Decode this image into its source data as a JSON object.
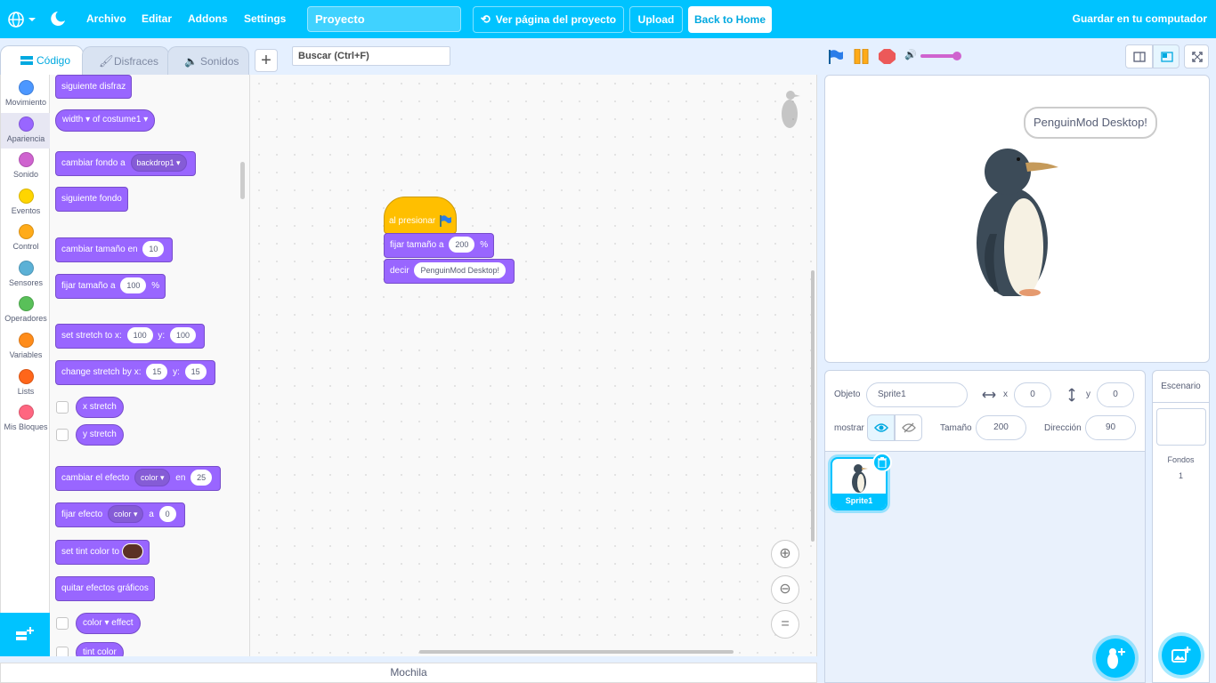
{
  "menubar": {
    "file": "Archivo",
    "edit": "Editar",
    "addons": "Addons",
    "settings": "Settings",
    "project_title": "Proyecto",
    "see_project_page": "Ver página del proyecto",
    "upload": "Upload",
    "back_home": "Back to Home",
    "save": "Guardar en tu computador"
  },
  "tabs": {
    "code": "Código",
    "costumes": "Disfraces",
    "sounds": "Sonidos"
  },
  "search": {
    "placeholder": "Buscar (Ctrl+F)"
  },
  "categories": [
    {
      "label": "Movimiento",
      "color": "#4c97ff"
    },
    {
      "label": "Apariencia",
      "color": "#9966ff"
    },
    {
      "label": "Sonido",
      "color": "#cf63cf"
    },
    {
      "label": "Eventos",
      "color": "#ffd500"
    },
    {
      "label": "Control",
      "color": "#ffab19"
    },
    {
      "label": "Sensores",
      "color": "#5cb1d6"
    },
    {
      "label": "Operadores",
      "color": "#59c059"
    },
    {
      "label": "Variables",
      "color": "#ff8c1a"
    },
    {
      "label": "Lists",
      "color": "#ff661a"
    },
    {
      "label": "Mis Bloques",
      "color": "#ff6680"
    }
  ],
  "palette": {
    "next_costume": "siguiente disfraz",
    "width_of": {
      "attr": "width",
      "of": "of",
      "target": "costume1"
    },
    "switch_backdrop": {
      "text": "cambiar fondo a",
      "value": "backdrop1"
    },
    "next_backdrop": "siguiente fondo",
    "change_size": {
      "text": "cambiar tamaño en",
      "value": "10"
    },
    "set_size": {
      "text": "fijar tamaño a",
      "value": "100",
      "unit": "%"
    },
    "set_stretch": {
      "text": "set stretch to x:",
      "x": "100",
      "y_label": "y:",
      "y": "100"
    },
    "change_stretch": {
      "text": "change stretch by x:",
      "x": "15",
      "y_label": "y:",
      "y": "15"
    },
    "x_stretch": "x stretch",
    "y_stretch": "y stretch",
    "change_effect": {
      "text": "cambiar el efecto",
      "effect": "color",
      "by": "en",
      "value": "25"
    },
    "set_effect": {
      "text": "fijar efecto",
      "effect": "color",
      "to": "a",
      "value": "0"
    },
    "set_tint": {
      "text": "set tint color to",
      "color": "#5b3126"
    },
    "clear_effects": "quitar efectos gráficos",
    "effect_reporter": {
      "effect": "color",
      "text": "effect"
    },
    "tint_color": "tint color"
  },
  "script": {
    "when_flag": "al presionar",
    "set_size": {
      "text": "fijar tamaño a",
      "value": "200",
      "unit": "%"
    },
    "say": {
      "text": "decir",
      "value": "PenguinMod Desktop!"
    }
  },
  "backpack": "Mochila",
  "stage": {
    "bubble": "PenguinMod Desktop!",
    "volume_percent": 100
  },
  "sprite_info": {
    "object_label": "Objeto",
    "name": "Sprite1",
    "x_label": "x",
    "x": "0",
    "y_label": "y",
    "y": "0",
    "show_label": "mostrar",
    "size_label": "Tamaño",
    "size": "200",
    "direction_label": "Dirección",
    "direction": "90"
  },
  "sprites": [
    {
      "name": "Sprite1"
    }
  ],
  "stage_pane": {
    "title": "Escenario",
    "backdrops_label": "Fondos",
    "backdrops_count": "1"
  },
  "colors": {
    "accent": "#00c3ff",
    "looks": "#9966ff",
    "events": "#ffbf00"
  }
}
